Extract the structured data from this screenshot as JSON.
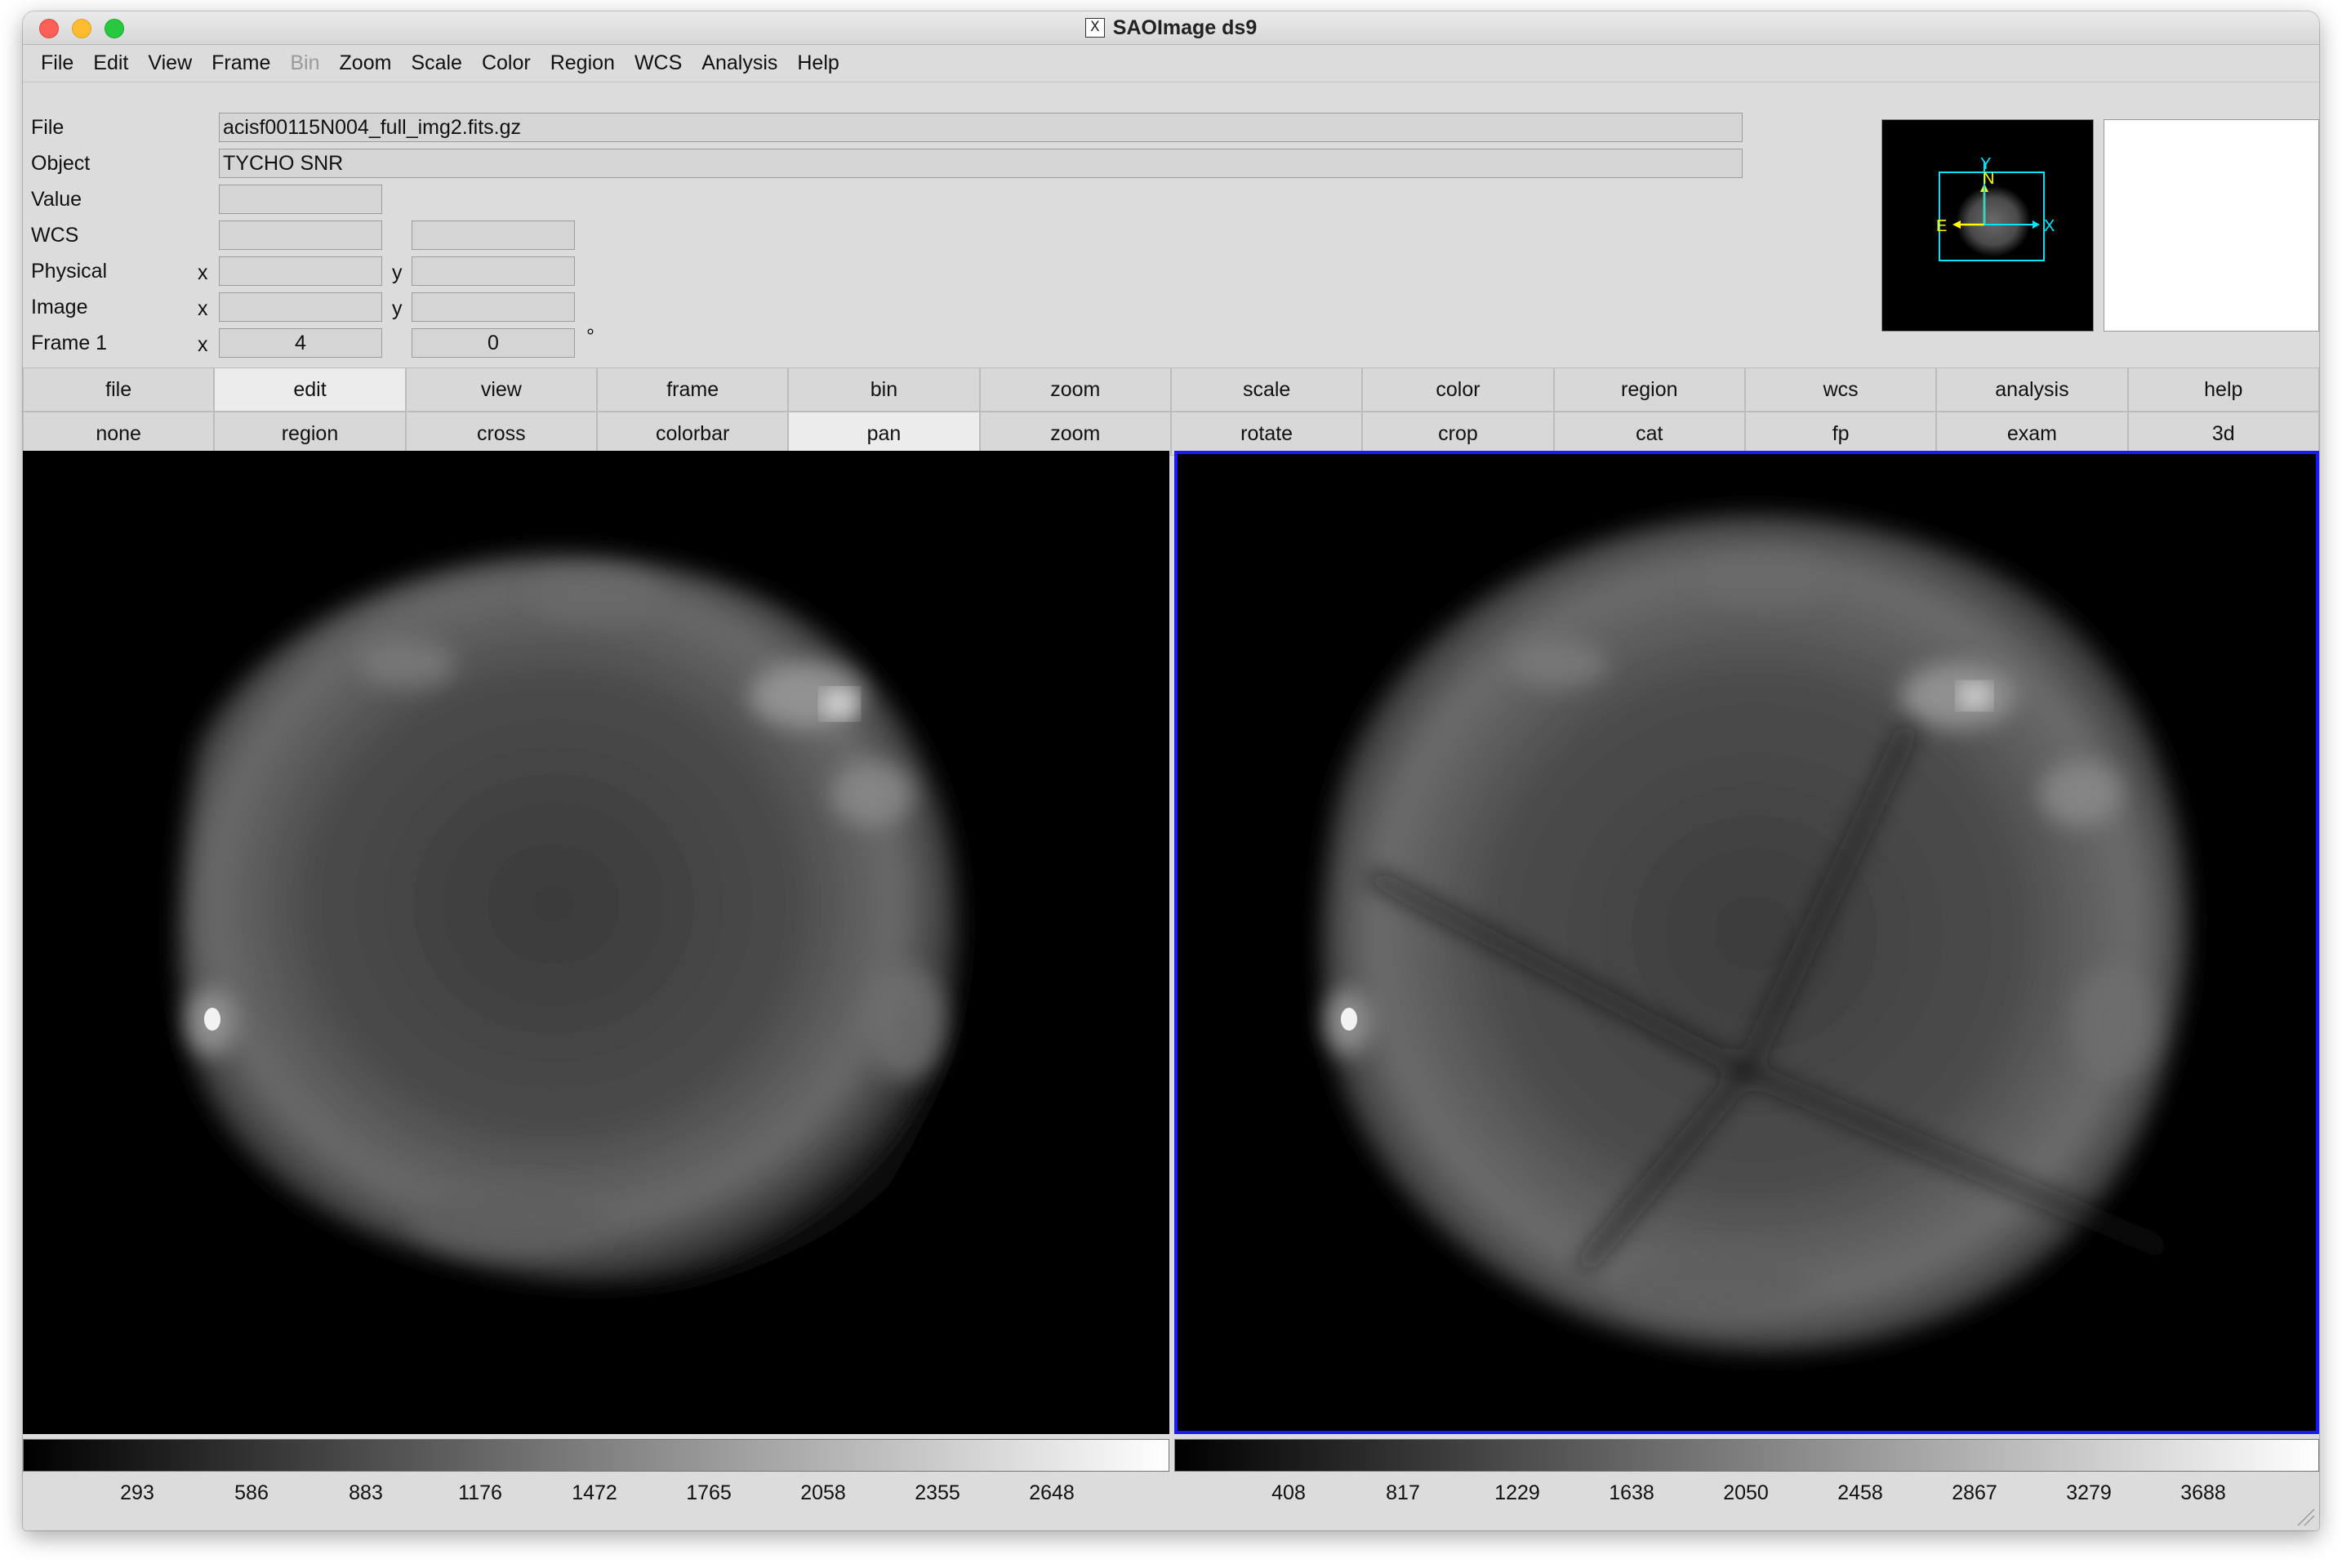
{
  "window": {
    "title": "SAOImage ds9",
    "title_icon": "x11-icon"
  },
  "menu": [
    "File",
    "Edit",
    "View",
    "Frame",
    "Bin",
    "Zoom",
    "Scale",
    "Color",
    "Region",
    "WCS",
    "Analysis",
    "Help"
  ],
  "menu_disabled": [
    "Bin"
  ],
  "info": {
    "file_label": "File",
    "file_value": "acisf00115N004_full_img2.fits.gz",
    "object_label": "Object",
    "object_value": "TYCHO SNR",
    "value_label": "Value",
    "value_value": "",
    "wcs_label": "WCS",
    "wcs_value1": "",
    "wcs_value2": "",
    "physical_label": "Physical",
    "physical_x": "",
    "physical_y": "",
    "image_label": "Image",
    "image_x": "",
    "image_y": "",
    "frame_label": "Frame 1",
    "frame_zoom": "4",
    "frame_angle": "0",
    "x_label": "x",
    "y_label": "y",
    "degree_symbol": "°"
  },
  "panner": {
    "label_n": "N",
    "label_e": "E",
    "label_x": "X",
    "label_y": "Y"
  },
  "buttons_main": [
    "file",
    "edit",
    "view",
    "frame",
    "bin",
    "zoom",
    "scale",
    "color",
    "region",
    "wcs",
    "analysis",
    "help"
  ],
  "buttons_main_active": "edit",
  "buttons_sub": [
    "none",
    "region",
    "cross",
    "colorbar",
    "pan",
    "zoom",
    "rotate",
    "crop",
    "cat",
    "fp",
    "exam",
    "3d"
  ],
  "buttons_sub_active": "pan",
  "colorbar1": {
    "ticks": [
      "293",
      "586",
      "883",
      "1176",
      "1472",
      "1765",
      "2058",
      "2355",
      "2648"
    ]
  },
  "colorbar2": {
    "ticks": [
      "408",
      "817",
      "1229",
      "1638",
      "2050",
      "2458",
      "2867",
      "3279",
      "3688"
    ]
  },
  "colors": {
    "accent_frame_border": "#1a1aff",
    "panner_box": "#00e5ff",
    "panner_compass": "#ffff00"
  }
}
